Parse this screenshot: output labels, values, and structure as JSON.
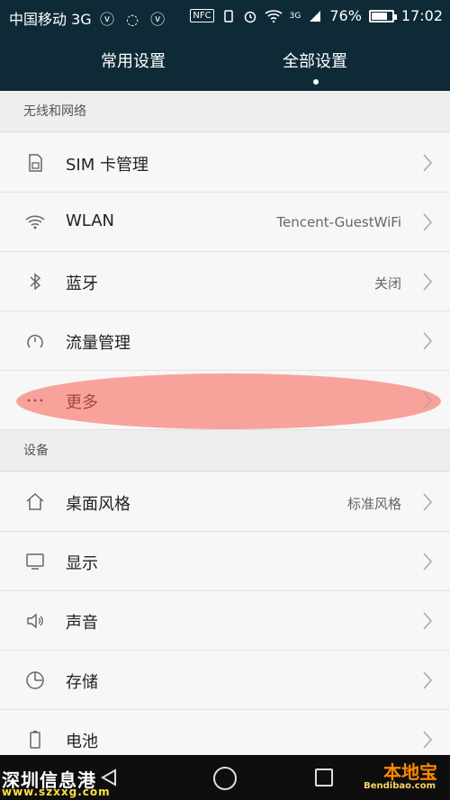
{
  "status_bar": {
    "carrier": "中国移动 3G",
    "left_icons": "ⓥ ◌ ⓥ",
    "nfc": "NFC",
    "network": "3G",
    "battery_percent": "76%",
    "battery_level": 0.76,
    "time": "17:02"
  },
  "tabs": [
    "常用设置",
    "全部设置"
  ],
  "sections": {
    "wireless": {
      "title": "无线和网络",
      "rows": [
        {
          "icon": "sim-card-icon",
          "label": "SIM 卡管理",
          "value": ""
        },
        {
          "icon": "wifi-icon",
          "label": "WLAN",
          "value": "Tencent-GuestWiFi"
        },
        {
          "icon": "bluetooth-icon",
          "label": "蓝牙",
          "value": "关闭"
        },
        {
          "icon": "data-usage-icon",
          "label": "流量管理",
          "value": ""
        },
        {
          "icon": "more-icon",
          "label": "更多",
          "value": ""
        }
      ]
    },
    "device": {
      "title": "设备",
      "rows": [
        {
          "icon": "home-icon",
          "label": "桌面风格",
          "value": "标准风格"
        },
        {
          "icon": "display-icon",
          "label": "显示",
          "value": ""
        },
        {
          "icon": "volume-icon",
          "label": "声音",
          "value": ""
        },
        {
          "icon": "storage-icon",
          "label": "存储",
          "value": ""
        },
        {
          "icon": "battery-icon",
          "label": "电池",
          "value": ""
        }
      ]
    }
  },
  "watermark": {
    "left_title": "深圳信息港",
    "left_url": "www.szxxg.com",
    "right_logo": "本地宝",
    "right_domain": "Bendibao.com"
  },
  "colors": {
    "header_bg": "#0f2a37",
    "highlight": "#f68278"
  }
}
